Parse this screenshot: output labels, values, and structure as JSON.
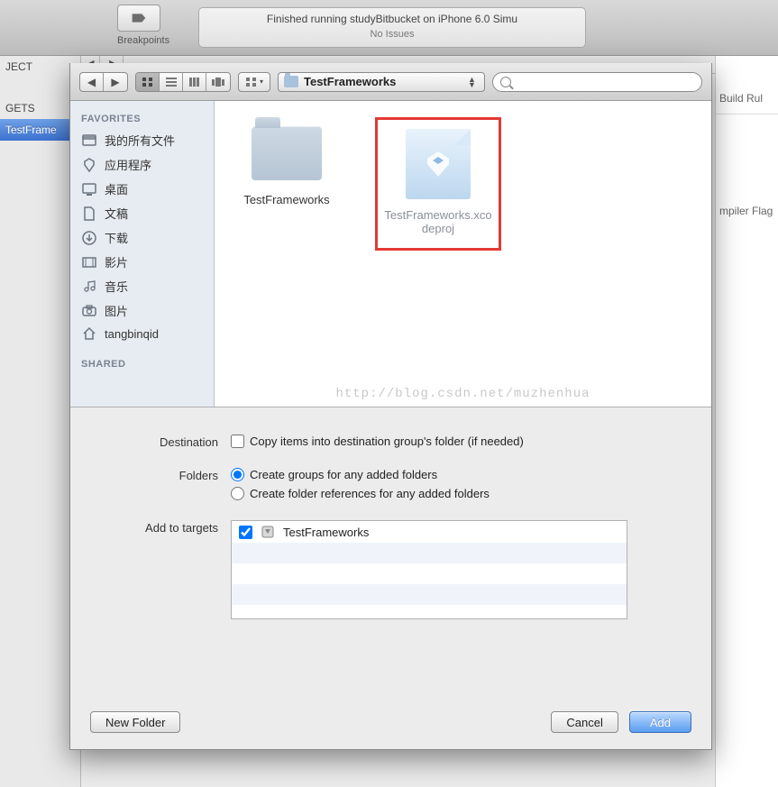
{
  "bg": {
    "breakpoints_label": "Breakpoints",
    "status_line1": "Finished running studyBitbucket on iPhone 6.0 Simu",
    "status_line2": "No Issues",
    "nav": {
      "project": "JECT",
      "targets": "GETS",
      "target_selected": "TestFrame"
    },
    "right_tabs": {
      "build_rules": "Build Rul",
      "compiler_flags": "mpiler Flag"
    }
  },
  "toolbar": {
    "path_label": "TestFrameworks",
    "search_placeholder": ""
  },
  "sidebar": {
    "favorites_header": "FAVORITES",
    "items": [
      {
        "icon": "drive",
        "label": "我的所有文件"
      },
      {
        "icon": "apps",
        "label": "应用程序"
      },
      {
        "icon": "desktop",
        "label": "桌面"
      },
      {
        "icon": "documents",
        "label": "文稿"
      },
      {
        "icon": "downloads",
        "label": "下载"
      },
      {
        "icon": "movies",
        "label": "影片"
      },
      {
        "icon": "music",
        "label": "音乐"
      },
      {
        "icon": "pictures",
        "label": "图片"
      },
      {
        "icon": "home",
        "label": "tangbinqid"
      }
    ],
    "shared_header": "SHARED"
  },
  "files": {
    "folder_name": "TestFrameworks",
    "project_name": "TestFrameworks.xcodeproj"
  },
  "watermark": "http://blog.csdn.net/muzhenhua",
  "options": {
    "destination_label": "Destination",
    "destination_checkbox": "Copy items into destination group's folder (if needed)",
    "folders_label": "Folders",
    "folders_opt1": "Create groups for any added folders",
    "folders_opt2": "Create folder references for any added folders",
    "targets_label": "Add to targets",
    "target_name": "TestFrameworks"
  },
  "buttons": {
    "new_folder": "New Folder",
    "cancel": "Cancel",
    "add": "Add"
  }
}
